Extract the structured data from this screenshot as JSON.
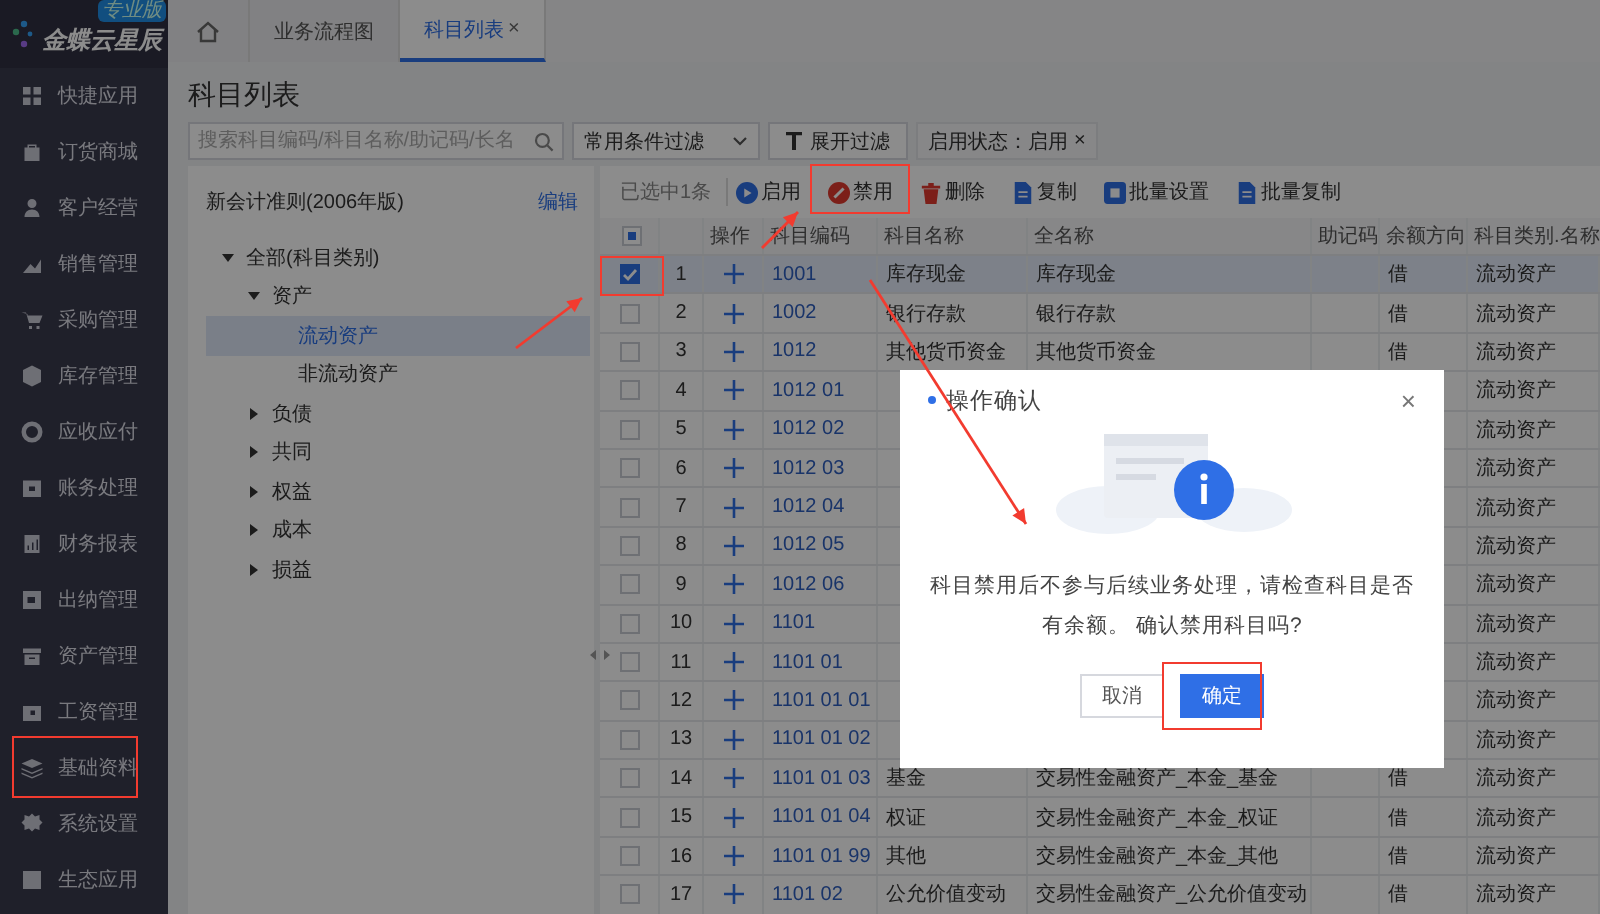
{
  "app": {
    "logo": "金蝶云星辰",
    "edition_badge": "专业版"
  },
  "sidebar": {
    "items": [
      {
        "label": "快捷应用"
      },
      {
        "label": "订货商城"
      },
      {
        "label": "客户经营"
      },
      {
        "label": "销售管理"
      },
      {
        "label": "采购管理"
      },
      {
        "label": "库存管理"
      },
      {
        "label": "应收应付"
      },
      {
        "label": "账务处理"
      },
      {
        "label": "财务报表"
      },
      {
        "label": "出纳管理"
      },
      {
        "label": "资产管理"
      },
      {
        "label": "工资管理"
      },
      {
        "label": "基础资料"
      },
      {
        "label": "系统设置"
      },
      {
        "label": "生态应用"
      }
    ]
  },
  "tabs": [
    {
      "kind": "home",
      "selected": false
    },
    {
      "kind": "page",
      "label": "业务流程图",
      "selected": false
    },
    {
      "kind": "page",
      "label": "科目列表",
      "close": "×",
      "selected": true
    }
  ],
  "page": {
    "title": "科目列表"
  },
  "filters": {
    "search": {
      "placeholder": "搜索科目编码/科目名称/助记码/长名"
    },
    "preset": {
      "value": "常用条件过滤"
    },
    "expand_button": "展开过滤",
    "active_filter": {
      "label": "启用状态：启用",
      "remove": "×"
    }
  },
  "tree_panel": {
    "title": "新会计准则(2006年版)",
    "edit_link": "编辑",
    "tree": [
      {
        "label": "全部(科目类别)",
        "expanded": true,
        "selected": false,
        "children": [
          {
            "label": "资产",
            "expanded": true,
            "selected": false,
            "children": [
              {
                "label": "流动资产",
                "selected": true
              },
              {
                "label": "非流动资产",
                "selected": false
              }
            ]
          },
          {
            "label": "负债",
            "expanded": false,
            "selected": false
          },
          {
            "label": "共同",
            "expanded": false,
            "selected": false
          },
          {
            "label": "权益",
            "expanded": false,
            "selected": false
          },
          {
            "label": "成本",
            "expanded": false,
            "selected": false
          },
          {
            "label": "损益",
            "expanded": false,
            "selected": false
          }
        ]
      }
    ]
  },
  "toolbar": {
    "selection_count": "已选中1条",
    "buttons": [
      {
        "kind": "enable",
        "label": "启用"
      },
      {
        "kind": "disable",
        "label": "禁用"
      },
      {
        "kind": "delete",
        "label": "删除"
      },
      {
        "kind": "copy",
        "label": "复制"
      },
      {
        "kind": "batch_set",
        "label": "批量设置"
      },
      {
        "kind": "batch_copy",
        "label": "批量复制"
      }
    ]
  },
  "table": {
    "header_checkbox": {
      "partial": true
    },
    "columns": [
      "操作",
      "科目编码",
      "科目名称",
      "全名称",
      "助记码",
      "余额方向",
      "科目类别.名称"
    ],
    "rows": [
      {
        "checked": true,
        "no": "1",
        "code": "1001",
        "name": "库存现金",
        "full_name": "库存现金",
        "direction": "借",
        "category": "流动资产"
      },
      {
        "checked": false,
        "no": "2",
        "code": "1002",
        "name": "银行存款",
        "full_name": "银行存款",
        "direction": "借",
        "category": "流动资产"
      },
      {
        "checked": false,
        "no": "3",
        "code": "1012",
        "name": "其他货币资金",
        "full_name": "其他货币资金",
        "direction": "借",
        "category": "流动资产"
      },
      {
        "checked": false,
        "no": "4",
        "code": "1012 01",
        "category": "流动资产"
      },
      {
        "checked": false,
        "no": "5",
        "code": "1012 02",
        "category": "流动资产"
      },
      {
        "checked": false,
        "no": "6",
        "code": "1012 03",
        "category": "流动资产"
      },
      {
        "checked": false,
        "no": "7",
        "code": "1012 04",
        "category": "流动资产"
      },
      {
        "checked": false,
        "no": "8",
        "code": "1012 05",
        "category": "流动资产"
      },
      {
        "checked": false,
        "no": "9",
        "code": "1012 06",
        "category": "流动资产"
      },
      {
        "checked": false,
        "no": "10",
        "code": "1101",
        "category": "流动资产"
      },
      {
        "checked": false,
        "no": "11",
        "code": "1101 01",
        "category": "流动资产"
      },
      {
        "checked": false,
        "no": "12",
        "code": "1101 01 01",
        "category": "流动资产"
      },
      {
        "checked": false,
        "no": "13",
        "code": "1101 01 02",
        "category": "流动资产"
      },
      {
        "checked": false,
        "no": "14",
        "code": "1101 01 03",
        "name": "基金",
        "full_name": "交易性金融资产_本金_基金",
        "direction": "借",
        "category": "流动资产"
      },
      {
        "checked": false,
        "no": "15",
        "code": "1101 01 04",
        "name": "权证",
        "full_name": "交易性金融资产_本金_权证",
        "direction": "借",
        "category": "流动资产"
      },
      {
        "checked": false,
        "no": "16",
        "code": "1101 01 99",
        "name": "其他",
        "full_name": "交易性金融资产_本金_其他",
        "direction": "借",
        "category": "流动资产"
      },
      {
        "checked": false,
        "no": "17",
        "code": "1101 02",
        "name": "公允价值变动",
        "full_name": "交易性金融资产_公允价值变动",
        "direction": "借",
        "category": "流动资产"
      }
    ]
  },
  "dialog": {
    "title": "操作确认",
    "close": "×",
    "message": "科目禁用后不参与后续业务处理，请检查科目是否有余额。 确认禁用科目吗?",
    "buttons": [
      {
        "kind": "secondary",
        "label": "取消"
      },
      {
        "kind": "primary",
        "label": "确定"
      }
    ]
  }
}
